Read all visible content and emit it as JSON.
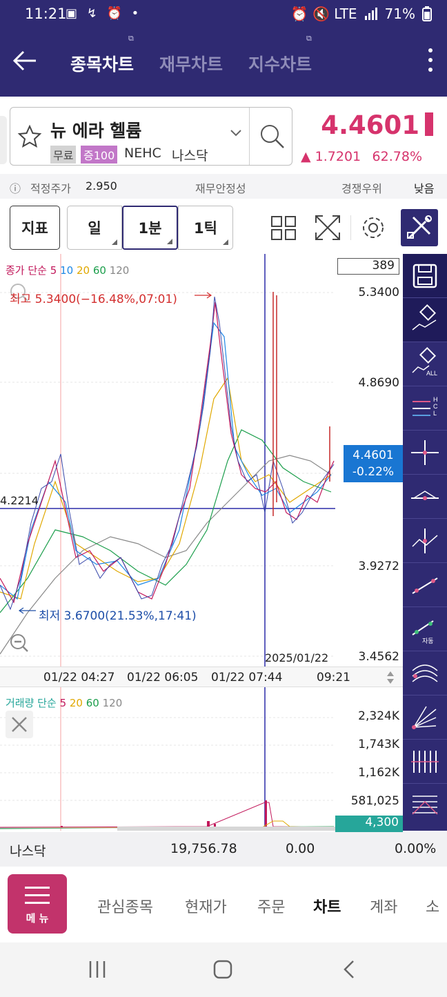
{
  "status_bar": {
    "time": "11:21",
    "left_icons": "▣ ↯ ⏰ •",
    "right_icons": "⏰ 🔇 LTE",
    "battery": "71%"
  },
  "app_bar": {
    "tabs": [
      {
        "label": "종목차트",
        "active": true
      },
      {
        "label": "재무차트",
        "active": false
      },
      {
        "label": "지수차트",
        "active": false
      }
    ]
  },
  "stock": {
    "name": "뉴 에라 헬륨",
    "badge_free": "무료",
    "badge_margin": "증100",
    "ticker": "NEHC",
    "market": "나스닥",
    "price": "4.4601",
    "change": "▲ 1.7201",
    "change_pct": "62.78%",
    "accent_color": "#d6336c"
  },
  "info_row": {
    "fair_price_label": "적정주가",
    "fair_price": "2.950",
    "financial_stability": "재무안정성",
    "competitive": "경쟁우위",
    "level": "낮음"
  },
  "toolbar": {
    "indicator": "지표",
    "day": "일",
    "minute": "1분",
    "tick": "1틱"
  },
  "chart": {
    "legend_main": {
      "prefix": "종가 단순",
      "p5": "5",
      "p10": "10",
      "p20": "20",
      "p60": "60",
      "p120": "120"
    },
    "legend_vol": {
      "prefix": "거래량 단순",
      "p5": "5",
      "p20": "20",
      "p60": "60",
      "p120": "120"
    },
    "count_box": "389",
    "max_label": "최고 5.3400(−16.48%,07:01)",
    "min_label": "최저 3.6700(21.53%,17:41)",
    "y_ticks": [
      "5.3400",
      "4.8690",
      "3.9272",
      "3.4562"
    ],
    "current_price": "4.4601",
    "current_pct": "-0.22%",
    "crosshair_value": "4.2214",
    "crosshair_date": "2025/01/22",
    "x_ticks": [
      "01/22 04:27",
      "01/22 06:05",
      "01/22 07:44",
      "09:21"
    ],
    "vol_ticks": [
      "2,324K",
      "1,743K",
      "1,162K",
      "581,025"
    ],
    "vol_current": "4,300",
    "sidebar_save_icon": "save-icon",
    "sidebar_erase_all": "ALL",
    "sidebar_hcl": "HCL",
    "sidebar_auto": "자동"
  },
  "chart_data": {
    "type": "line",
    "title": "",
    "xlabel": "",
    "ylabel": "",
    "x": [
      "01/22 04:27",
      "01/22 06:05",
      "01/22 07:44",
      "09:21"
    ],
    "ylim": [
      3.4562,
      5.34
    ],
    "series": [
      {
        "name": "종가",
        "values": [
          3.75,
          4.3,
          4.0,
          3.9,
          3.7,
          3.95,
          4.3,
          5.34,
          4.6,
          4.3,
          4.25,
          4.2,
          4.3,
          4.46
        ]
      }
    ],
    "high": 5.34,
    "low": 3.67,
    "grid": true
  },
  "index_row": {
    "name": "나스닥",
    "value": "19,756.78",
    "change": "0.00",
    "pct": "0.00%"
  },
  "bottom_nav": {
    "menu": "메 뉴",
    "items": [
      {
        "label": "관심종목",
        "active": false
      },
      {
        "label": "현재가",
        "active": false
      },
      {
        "label": "주문",
        "active": false
      },
      {
        "label": "차트",
        "active": true
      },
      {
        "label": "계좌",
        "active": false
      },
      {
        "label": "소",
        "active": false
      }
    ]
  }
}
